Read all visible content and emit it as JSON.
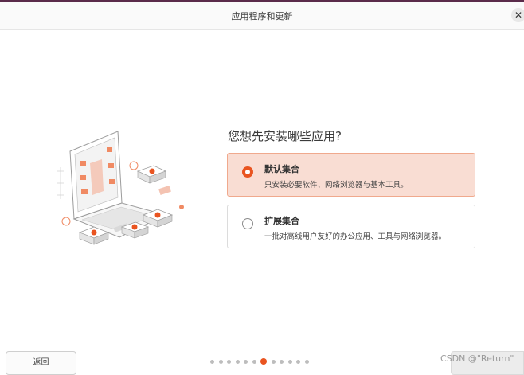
{
  "window": {
    "title": "应用程序和更新",
    "close_symbol": "✕"
  },
  "main": {
    "question": "您想先安装哪些应用?",
    "options": [
      {
        "label": "默认集合",
        "description": "只安装必要软件、网络浏览器与基本工具。",
        "selected": true
      },
      {
        "label": "扩展集合",
        "description": "一批对高线用户友好的办公应用、工具与网络浏览器。",
        "selected": false
      }
    ]
  },
  "footer": {
    "back_label": "返回",
    "page_count": 12,
    "current_page": 7,
    "watermark": "CSDN @\"Return\""
  },
  "colors": {
    "accent": "#e95420",
    "selected_bg": "#f9ddd3"
  },
  "icons": [
    "laptop-illustration",
    "close-icon"
  ]
}
